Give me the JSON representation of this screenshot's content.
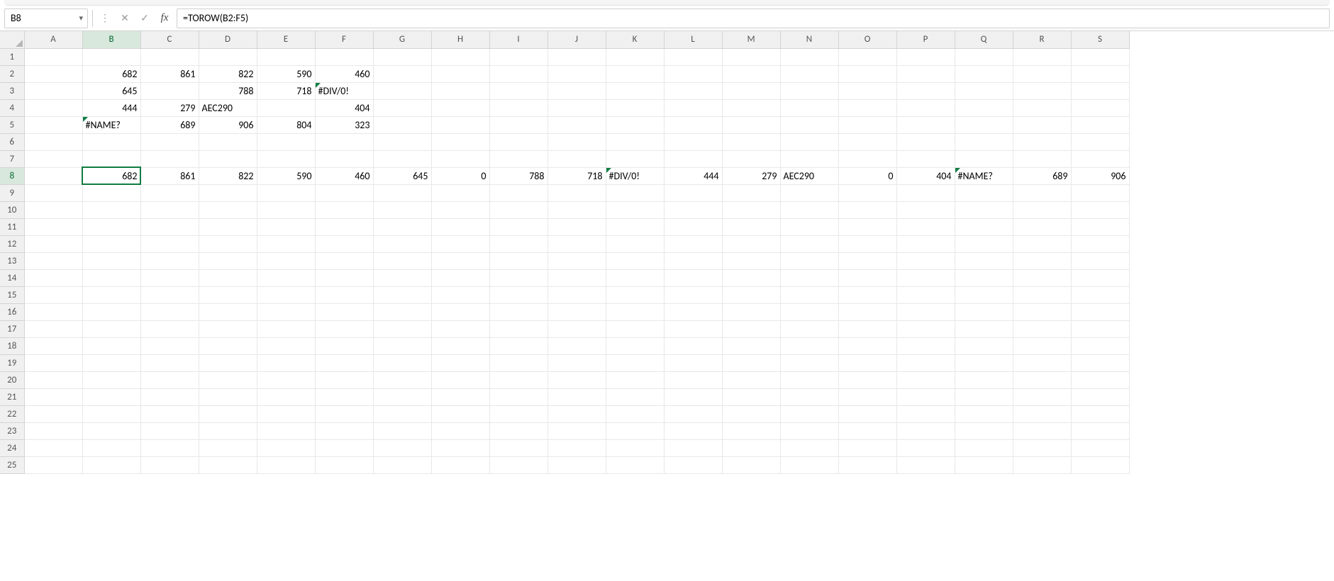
{
  "formula_bar": {
    "name_box": "B8",
    "cancel_glyph": "✕",
    "enter_glyph": "✓",
    "fx_glyph": "fx",
    "more_glyph": "⋮",
    "formula": "=TOROW(B2:F5)"
  },
  "columns": [
    "A",
    "B",
    "C",
    "D",
    "E",
    "F",
    "G",
    "H",
    "I",
    "J",
    "K",
    "L",
    "M",
    "N",
    "O",
    "P",
    "Q",
    "R",
    "S"
  ],
  "row_count": 25,
  "active_cell": {
    "row": 8,
    "col": "B"
  },
  "cells": {
    "B2": {
      "v": "682",
      "align": "num"
    },
    "C2": {
      "v": "861",
      "align": "num"
    },
    "D2": {
      "v": "822",
      "align": "num"
    },
    "E2": {
      "v": "590",
      "align": "num"
    },
    "F2": {
      "v": "460",
      "align": "num"
    },
    "B3": {
      "v": "645",
      "align": "num"
    },
    "D3": {
      "v": "788",
      "align": "num"
    },
    "E3": {
      "v": "718",
      "align": "num"
    },
    "F3": {
      "v": "#DIV/0!",
      "align": "txt",
      "err": true
    },
    "B4": {
      "v": "444",
      "align": "num"
    },
    "C4": {
      "v": "279",
      "align": "num"
    },
    "D4": {
      "v": "AEC290",
      "align": "txt"
    },
    "F4": {
      "v": "404",
      "align": "num"
    },
    "B5": {
      "v": "#NAME?",
      "align": "txt",
      "err": true
    },
    "C5": {
      "v": "689",
      "align": "num"
    },
    "D5": {
      "v": "906",
      "align": "num"
    },
    "E5": {
      "v": "804",
      "align": "num"
    },
    "F5": {
      "v": "323",
      "align": "num"
    },
    "B8": {
      "v": "682",
      "align": "num"
    },
    "C8": {
      "v": "861",
      "align": "num"
    },
    "D8": {
      "v": "822",
      "align": "num"
    },
    "E8": {
      "v": "590",
      "align": "num"
    },
    "F8": {
      "v": "460",
      "align": "num"
    },
    "G8": {
      "v": "645",
      "align": "num"
    },
    "H8": {
      "v": "0",
      "align": "num"
    },
    "I8": {
      "v": "788",
      "align": "num"
    },
    "J8": {
      "v": "718",
      "align": "num"
    },
    "K8": {
      "v": "#DIV/0!",
      "align": "txt",
      "err": true
    },
    "L8": {
      "v": "444",
      "align": "num"
    },
    "M8": {
      "v": "279",
      "align": "num"
    },
    "N8": {
      "v": "AEC290",
      "align": "txt"
    },
    "O8": {
      "v": "0",
      "align": "num"
    },
    "P8": {
      "v": "404",
      "align": "num"
    },
    "Q8": {
      "v": "#NAME?",
      "align": "txt",
      "err": true
    },
    "R8": {
      "v": "689",
      "align": "num"
    },
    "S8": {
      "v": "906",
      "align": "num"
    }
  }
}
